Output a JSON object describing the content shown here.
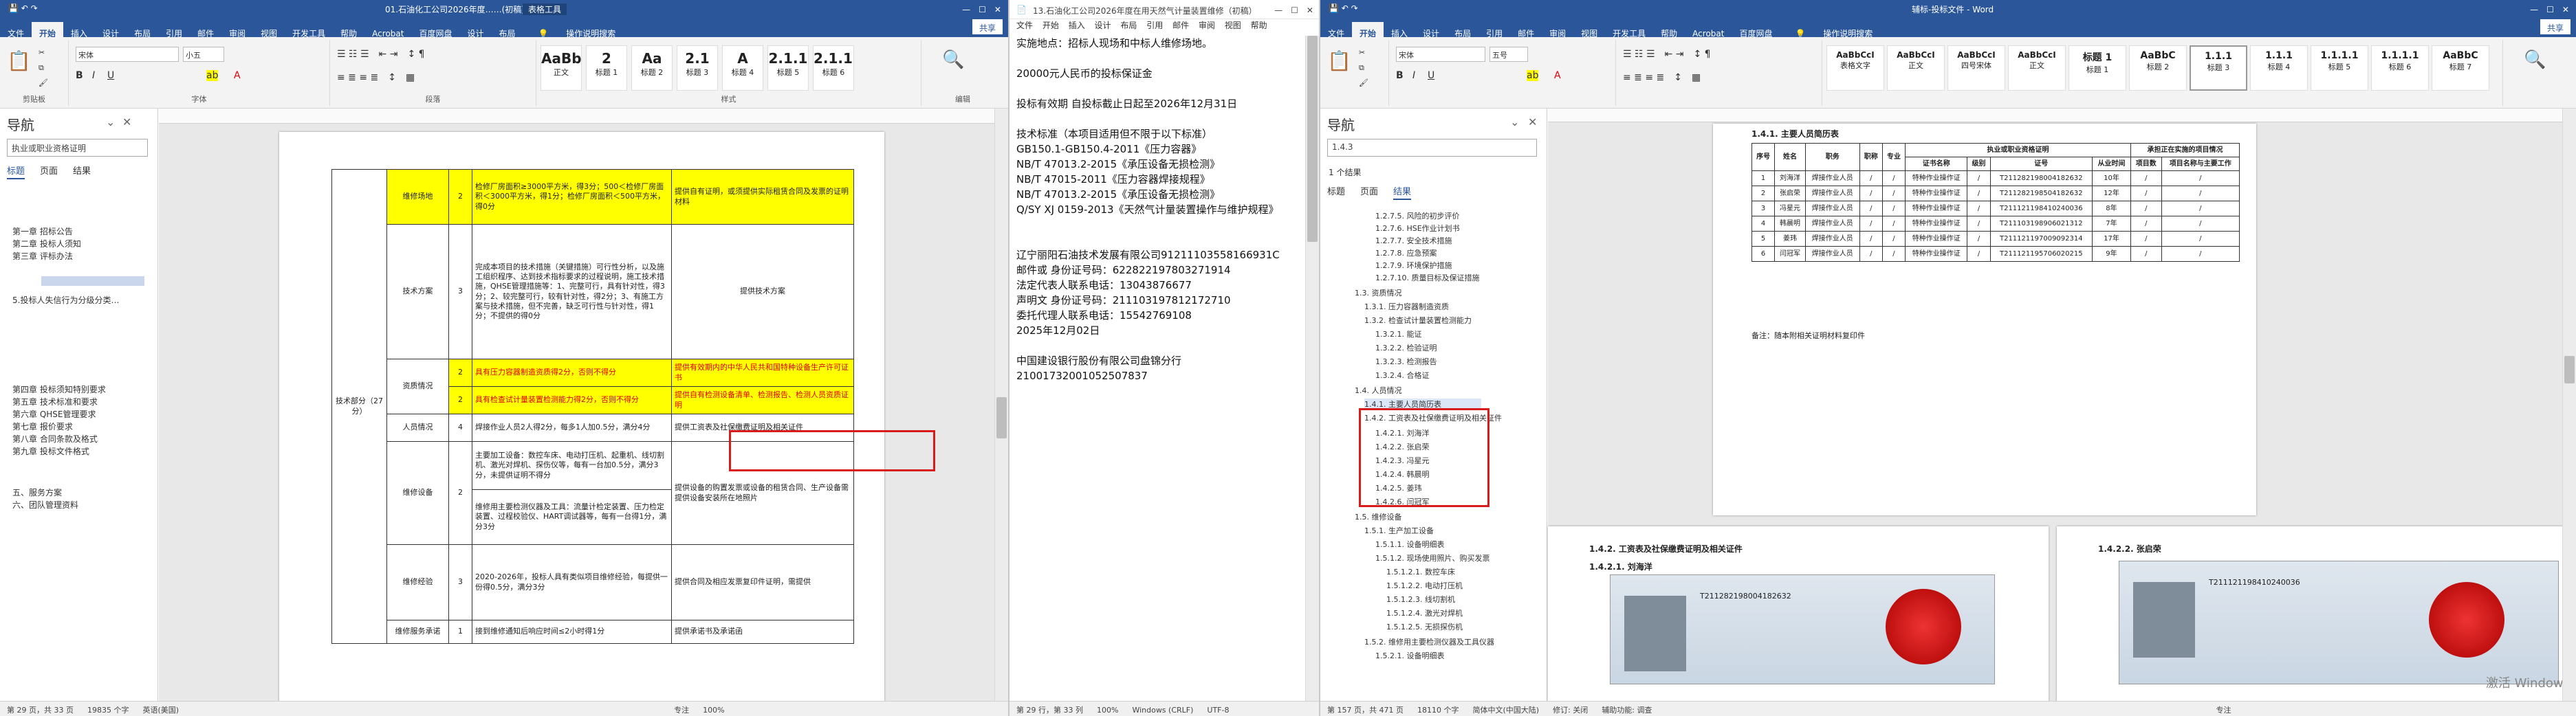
{
  "left": {
    "title": "01.石油化工公司2026年度……(初稿) - Word",
    "table_tools": "表格工具",
    "tabs": [
      "文件",
      "开始",
      "插入",
      "设计",
      "布局",
      "引用",
      "邮件",
      "审阅",
      "视图",
      "开发工具",
      "帮助",
      "Acrobat",
      "百度网盘",
      "设计",
      "布局",
      "操作说明搜索",
      "共享"
    ],
    "font_name": "宋体",
    "font_size": "小五",
    "styles": [
      {
        "preview": "AaBb(",
        "name": "正文"
      },
      {
        "preview": "2",
        "name": "标题 1"
      },
      {
        "preview": "Aa",
        "name": "标题 2"
      },
      {
        "preview": "2.1",
        "name": "标题 3"
      },
      {
        "preview": "A",
        "name": "标题 4"
      },
      {
        "preview": "2.1.1",
        "name": "标题 5"
      },
      {
        "preview": "2.1.1.1",
        "name": "标题 6"
      }
    ],
    "group_labels": [
      "剪贴板",
      "字体",
      "段落",
      "样式",
      "编辑"
    ],
    "nav": {
      "title": "导航",
      "search": "执业或职业资格证明",
      "subtabs": [
        "标题",
        "页面",
        "结果"
      ],
      "items": [
        "第一章 招标公告",
        "第二章 投标人须知",
        "第三章 评标办法",
        "5.投标人失信行为分级分类…",
        "第四章 投标须知特别要求",
        "第五章 技术标准和要求",
        "第六章 QHSE管理要求",
        "第七章 报价要求",
        "第八章 合同条款及格式",
        "第九章 投标文件格式",
        "五、服务方案",
        "六、团队管理资料"
      ]
    },
    "table": {
      "category": "技术部分（27 分）",
      "rows": [
        {
          "name": "维修场地",
          "score": "2",
          "criteria": "检修厂房面积≥3000平方米，得3分；500＜检修厂房面积＜3000平方米，得1分；检修厂房面积＜500平方米，得0分",
          "evidence": "提供自有证明，或须提供实际租赁合同及发票的证明材料"
        },
        {
          "name": "技术方案",
          "score": "3",
          "criteria": "完成本项目的技术措施（关键措施）可行性分析，以及施工组织程序、达到技术指标要求的过程说明，施工技术措施，QHSE管理措施等：1、完整可行，具有针对性，得3分；2、较完整可行，较有针对性，得2分；3、有施工方案与技术措施，但不完善，缺乏可行性与针对性，得1分；不提供的得0分",
          "evidence": "提供技术方案"
        },
        {
          "name": "资质情况",
          "score": "2",
          "criteria": "具有压力容器制造资质得2分，否则不得分",
          "evidence": "提供有效期内的中华人民共和国特种设备生产许可证书"
        },
        {
          "name": "",
          "score": "2",
          "criteria": "具有检查试计量装置检测能力得2分，否则不得分",
          "evidence": "提供自有检测设备清单、检测报告、检测人员资质证明"
        },
        {
          "name": "人员情况",
          "score": "4",
          "criteria": "焊接作业人员2人得2分，每多1人加0.5分，满分4分",
          "evidence": "提供工资表及社保缴费证明及相关证件"
        },
        {
          "name": "维修设备",
          "score": "2",
          "criteria": "主要加工设备：数控车床、电动打压机、起重机、线切割机、激光对焊机、探伤仪等，每有一台加0.5分，满分3分，未提供证明不得分",
          "evidence": ""
        },
        {
          "name": "",
          "score": "",
          "criteria": "维修用主要检测仪器及工具：流量计检定装置、压力检定装置、过程校验仪、HART调试器等，每有一台得1分，满分3分",
          "evidence": "提供设备的购置发票或设备的租赁合同、生产设备需提供设备安装所在地照片"
        },
        {
          "name": "维修经验",
          "score": "3",
          "criteria": "2020-2026年，投标人具有类似项目维修经验，每提供一份得0.5分，满分3分",
          "evidence": "提供合同及相应发票复印件证明，需提供"
        },
        {
          "name": "维修服务承诺",
          "score": "1",
          "criteria": "接到维修通知后响应时间≤2小时得1分",
          "evidence": "提供承诺书及承诺函"
        }
      ]
    },
    "status": [
      "第 29 页，共 33 页",
      "19835 个字",
      "英语(美国)",
      "专注",
      "100%"
    ]
  },
  "middle": {
    "title": "13.石油化工公司2026年度在用天然气计量装置维修（初稿）",
    "tabs": [
      "文件",
      "开始",
      "插入",
      "设计",
      "布局",
      "引用",
      "邮件",
      "审阅",
      "视图",
      "帮助"
    ],
    "lines": [
      "实施地点：招标人现场和中标人维修场地。",
      "",
      "20000元人民币的投标保证金",
      "",
      "投标有效期 自投标截止日起至2026年12月31日",
      "",
      "技术标准（本项目适用但不限于以下标准）",
      "GB150.1-GB150.4-2011《压力容器》",
      "NB/T 47013.2-2015《承压设备无损检测》",
      "NB/T 47015-2011《压力容器焊接规程》",
      "NB/T 47013.2-2015《承压设备无损检测》",
      "Q/SY XJ 0159-2013《天然气计量装置操作与维护规程》",
      "",
      "",
      "",
      "辽宁丽阳石油技术发展有限公司91211103558166931C",
      "邮件或    身份证号码：622822197803271914",
      "法定代表人联系电话：13043876677",
      "声明文    身份证号码：211103197812172710",
      "委托代理人联系电话：15542769108",
      "2025年12月02日",
      "",
      "中国建设银行股份有限公司盘锦分行",
      "21001732001052507837"
    ],
    "status": [
      "第 29 行，第 33 列",
      "100%",
      "Windows (CRLF)",
      "UTF-8"
    ]
  },
  "right": {
    "title": "辅标-投标文件 - Word",
    "tabs": [
      "文件",
      "开始",
      "插入",
      "设计",
      "布局",
      "引用",
      "邮件",
      "审阅",
      "视图",
      "开发工具",
      "帮助",
      "Acrobat",
      "百度网盘",
      "操作说明搜索",
      "共享"
    ],
    "font_name": "宋体",
    "font_size": "五号",
    "styles": [
      {
        "preview": "AaBbCcI",
        "name": "表格文字"
      },
      {
        "preview": "AaBbCcI",
        "name": "正文"
      },
      {
        "preview": "AaBbCcI",
        "name": "四号宋体"
      },
      {
        "preview": "AaBbCcI",
        "name": "正文"
      },
      {
        "preview": "标题 1",
        "name": "标题 1"
      },
      {
        "preview": "AaBbC",
        "name": "标题 2"
      },
      {
        "preview": "1.1.1",
        "name": "标题 3"
      },
      {
        "preview": "1.1.1",
        "name": "标题 4"
      },
      {
        "preview": "1.1.1.1",
        "name": "标题 5"
      },
      {
        "preview": "1.1.1.1",
        "name": "标题 6"
      },
      {
        "preview": "AaBbC",
        "name": "标题 7"
      }
    ],
    "nav": {
      "title": "导航",
      "search": "1.4.3",
      "result_count": "1 个结果",
      "subtabs": [
        "标题",
        "页面",
        "结果"
      ],
      "items": [
        "1.2.7.5. 风险的初步评价",
        "1.2.7.6. HSE作业计划书",
        "1.2.7.7. 安全技术措施",
        "1.2.7.8. 应急预案",
        "1.2.7.9. 环境保护措施",
        "1.2.7.10. 质量目标及保证措施",
        "1.3. 资质情况",
        "1.3.1. 压力容器制造资质",
        "1.3.2. 检查试计量装置检测能力",
        "1.3.2.1. 能证",
        "1.3.2.2. 检验证明",
        "1.3.2.3. 检测报告",
        "1.3.2.4. 合格证",
        "1.4. 人员情况",
        "1.4.1. 主要人员简历表",
        "1.4.2. 工资表及社保缴费证明及相关证件",
        "1.4.2.1. 刘海洋",
        "1.4.2.2. 张启荣",
        "1.4.2.3. 冯星元",
        "1.4.2.4. 韩晨明",
        "1.4.2.5. 姜玮",
        "1.4.2.6. 闫冠军",
        "1.5. 维修设备",
        "1.5.1. 生产加工设备",
        "1.5.1.1. 设备明细表",
        "1.5.1.2. 现场使用照片、购买发票",
        "1.5.1.2.1. 数控车床",
        "1.5.1.2.2. 电动打压机",
        "1.5.1.2.3. 线切割机",
        "1.5.1.2.4. 激光对焊机",
        "1.5.1.2.5. 无损探伤机",
        "1.5.2. 维修用主要检测仪器及工具仪器",
        "1.5.2.1. 设备明细表"
      ]
    },
    "table_heading": "1.4.1. 主要人员简历表",
    "table_headers": [
      "序号",
      "姓名",
      "职务",
      "职称",
      "专业",
      "执业或职业资格证明",
      "",
      "",
      "",
      "",
      "承担正在实施的项目情况",
      ""
    ],
    "sub_headers": [
      "证书名称",
      "级别",
      "证号",
      "从业时间",
      "项目数",
      "项目名称与主要工作"
    ],
    "persons": [
      {
        "no": "1",
        "name": "刘海洋",
        "role": "焊接作业人员",
        "title": "/",
        "major": "/",
        "cert": "特种作业操作证",
        "level": "/",
        "certno": "T211282198004182632",
        "years": "10年",
        "projects": "/",
        "work": "/"
      },
      {
        "no": "2",
        "name": "张启荣",
        "role": "焊接作业人员",
        "title": "/",
        "major": "/",
        "cert": "特种作业操作证",
        "level": "/",
        "certno": "T211282198504182632",
        "years": "12年",
        "projects": "/",
        "work": "/"
      },
      {
        "no": "3",
        "name": "冯星元",
        "role": "焊接作业人员",
        "title": "/",
        "major": "/",
        "cert": "特种作业操作证",
        "level": "/",
        "certno": "T211121198410240036",
        "years": "8年",
        "projects": "/",
        "work": "/"
      },
      {
        "no": "4",
        "name": "韩晨明",
        "role": "焊接作业人员",
        "title": "/",
        "major": "/",
        "cert": "特种作业操作证",
        "level": "/",
        "certno": "T211103198906021312",
        "years": "7年",
        "projects": "/",
        "work": "/"
      },
      {
        "no": "5",
        "name": "姜玮",
        "role": "焊接作业人员",
        "title": "/",
        "major": "/",
        "cert": "特种作业操作证",
        "level": "/",
        "certno": "T211121197009092314",
        "years": "17年",
        "projects": "/",
        "work": "/"
      },
      {
        "no": "6",
        "name": "闫冠军",
        "role": "焊接作业人员",
        "title": "/",
        "major": "/",
        "cert": "特种作业操作证",
        "level": "/",
        "certno": "T211121195706020215",
        "years": "9年",
        "projects": "/",
        "work": "/"
      }
    ],
    "note": "备注：随本附相关证明材料复印件",
    "page_heading_a": "1.4.2. 工资表及社保缴费证明及相关证件",
    "page_heading_a2": "1.4.2.1. 刘海洋",
    "page_heading_b": "1.4.2.2. 张启荣",
    "cert_a": "T211282198004182632",
    "cert_b": "T211121198410240036",
    "watermark": "激活 Windows",
    "status": [
      "第 157 页，共 471 页",
      "18110 个字",
      "简体中文(中国大陆)",
      "修订: 关闭",
      "辅助功能: 调查",
      "专注"
    ]
  }
}
